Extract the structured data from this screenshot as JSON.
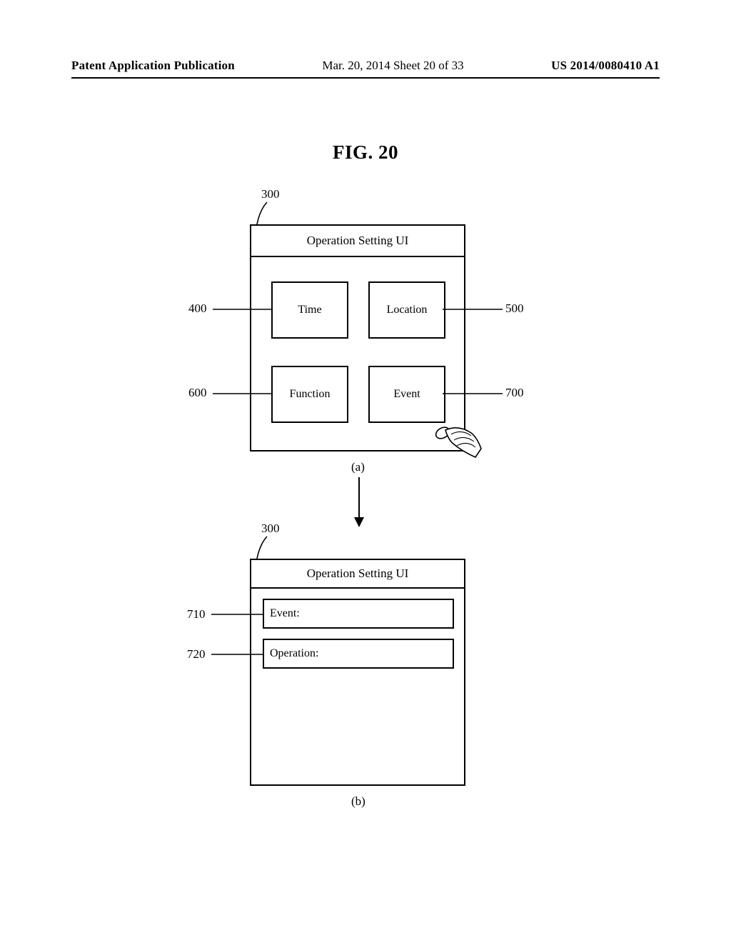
{
  "header": {
    "left": "Patent Application Publication",
    "center": "Mar. 20, 2014  Sheet 20 of 33",
    "right": "US 2014/0080410 A1"
  },
  "figure": {
    "title": "FIG. 20",
    "sub_a": "(a)",
    "sub_b": "(b)"
  },
  "panelA": {
    "title": "Operation Setting UI",
    "tiles": {
      "time": "Time",
      "location": "Location",
      "function": "Function",
      "event": "Event"
    }
  },
  "panelB": {
    "title": "Operation Setting UI",
    "fields": {
      "event": "Event:",
      "operation": "Operation:"
    }
  },
  "callouts": {
    "a_frame": "300",
    "a_time": "400",
    "a_location": "500",
    "a_function": "600",
    "a_event": "700",
    "b_frame": "300",
    "b_event": "710",
    "b_operation": "720"
  }
}
